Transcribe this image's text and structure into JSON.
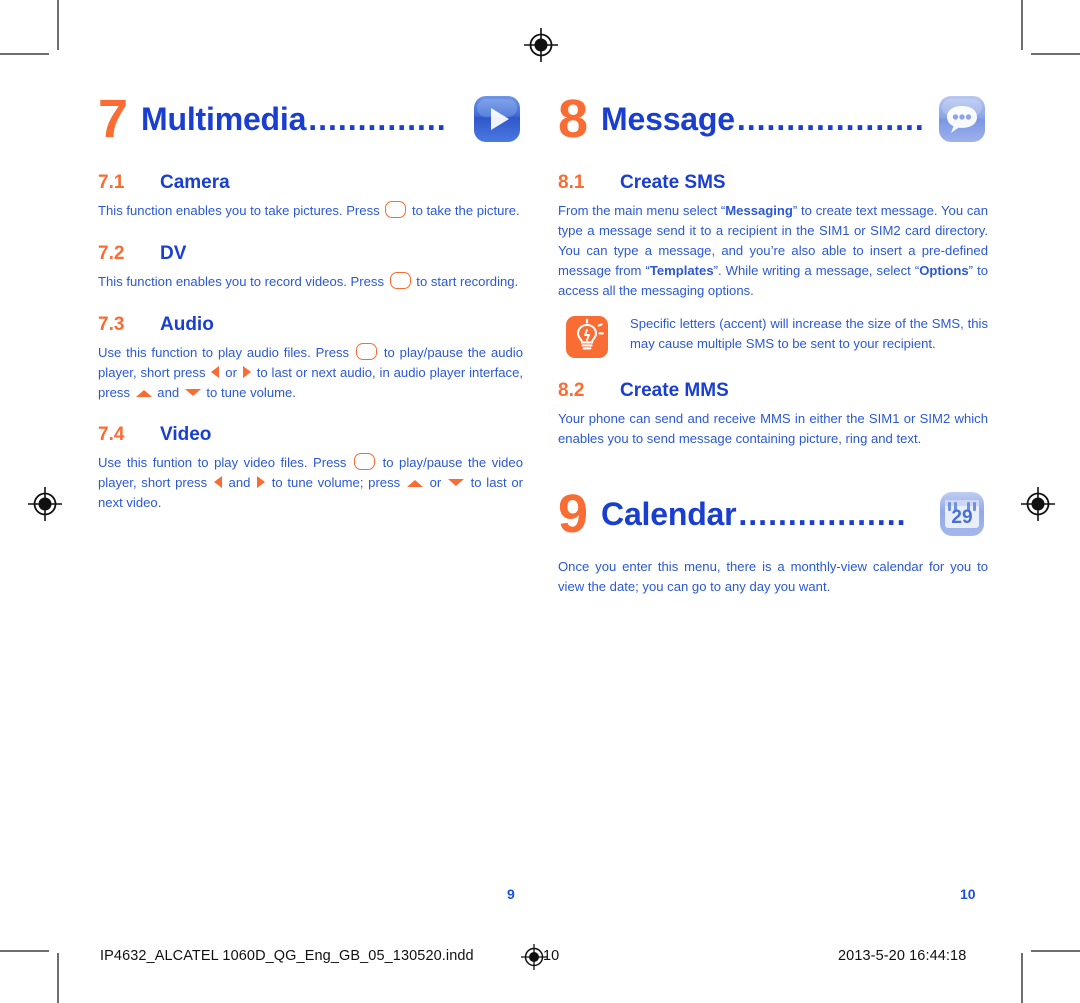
{
  "document": {
    "type": "print-proof-page",
    "colors": {
      "accent_orange": "#f96c33",
      "heading_blue": "#1a3fd0",
      "body_blue": "#2b58d6",
      "icon_blue": "#4a6fd4",
      "icon_lightblue": "#8fa6e8"
    }
  },
  "left_page": {
    "chapter": {
      "number": "7",
      "title": "Multimedia",
      "dots": "..............",
      "icon": "media-play-icon"
    },
    "sections": [
      {
        "number": "7.1",
        "title": "Camera",
        "paragraphs": [
          {
            "parts": [
              {
                "t": "text",
                "v": "This function enables you to take pictures. Press "
              },
              {
                "t": "key",
                "v": "ok-key-icon"
              },
              {
                "t": "text",
                "v": " to take the picture."
              }
            ]
          }
        ]
      },
      {
        "number": "7.2",
        "title": "DV",
        "paragraphs": [
          {
            "parts": [
              {
                "t": "text",
                "v": "This function enables you to record videos. Press "
              },
              {
                "t": "key",
                "v": "ok-key-icon"
              },
              {
                "t": "text",
                "v": " to start recording."
              }
            ]
          }
        ]
      },
      {
        "number": "7.3",
        "title": "Audio",
        "paragraphs": [
          {
            "parts": [
              {
                "t": "text",
                "v": "Use this function to play audio files. Press "
              },
              {
                "t": "key",
                "v": "ok-key-icon"
              },
              {
                "t": "text",
                "v": " to play/pause the audio player, short press "
              },
              {
                "t": "tri-left",
                "v": "arrow-left-icon"
              },
              {
                "t": "text",
                "v": " or "
              },
              {
                "t": "tri-right",
                "v": "arrow-right-icon"
              },
              {
                "t": "text",
                "v": " to last or next audio, in audio player interface, press "
              },
              {
                "t": "tri-up",
                "v": "arrow-up-icon"
              },
              {
                "t": "text",
                "v": " and "
              },
              {
                "t": "tri-down",
                "v": "arrow-down-icon"
              },
              {
                "t": "text",
                "v": " to tune volume."
              }
            ]
          }
        ]
      },
      {
        "number": "7.4",
        "title": "Video",
        "paragraphs": [
          {
            "parts": [
              {
                "t": "text",
                "v": "Use this funtion to play video files. Press "
              },
              {
                "t": "key",
                "v": "ok-key-icon"
              },
              {
                "t": "text",
                "v": " to play/pause the video player, short press "
              },
              {
                "t": "tri-left",
                "v": "arrow-left-icon"
              },
              {
                "t": "text",
                "v": " and "
              },
              {
                "t": "tri-right",
                "v": "arrow-right-icon"
              },
              {
                "t": "text",
                "v": " to tune volume; press "
              },
              {
                "t": "tri-up",
                "v": "arrow-up-icon"
              },
              {
                "t": "text",
                "v": " or "
              },
              {
                "t": "tri-down",
                "v": "arrow-down-icon"
              },
              {
                "t": "text",
                "v": " to last or next video."
              }
            ]
          }
        ]
      }
    ],
    "page_number": "9"
  },
  "right_page": {
    "chapter": {
      "number": "8",
      "title": "Message",
      "dots": "...................",
      "icon": "message-bubble-icon"
    },
    "sections": [
      {
        "number": "8.1",
        "title": "Create SMS",
        "paragraph_html": "From the main menu select “<b>Messaging</b>” to create text message. You can type a message send it to a recipient in the SIM1 or SIM2 card directory. You can type a message, and you’re also able to insert a pre-defined message from “<b>Templates</b>”. While writing a message, select “<b>Options</b>” to access all the messaging options."
      },
      {
        "number": "8.2",
        "title": "Create MMS",
        "paragraph_html": "Your phone can send and receive MMS in either the SIM1 or SIM2 which enables you to send message containing picture, ring and text."
      }
    ],
    "tip": {
      "icon": "lightbulb-tip-icon",
      "text": "Specific letters (accent) will increase the size of the SMS, this may cause multiple SMS to be sent to your recipient."
    },
    "chapter2": {
      "number": "9",
      "title": "Calendar",
      "dots": ".................",
      "icon": "calendar-29-icon",
      "paragraph": "Once you enter this menu, there is a monthly-view calendar for you to view the date; you can go to any day you want."
    },
    "page_number": "10"
  },
  "footer": {
    "file_name": "IP4632_ALCATEL 1060D_QG_Eng_GB_05_130520.indd",
    "page_pair": "10",
    "timestamp": "2013-5-20   16:44:18",
    "registration_icon": "registration-target-icon"
  }
}
